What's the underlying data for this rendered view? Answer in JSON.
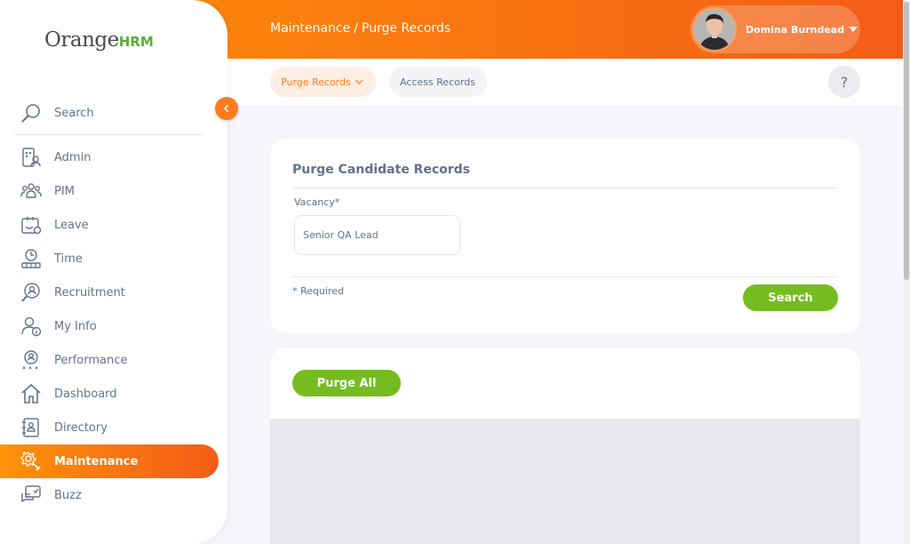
{
  "header": {
    "breadcrumb_module": "Maintenance",
    "breadcrumb_sep": "/",
    "breadcrumb_page": "Purge Records",
    "user_name": "Domina Burndead",
    "help_label": "?"
  },
  "subnav": {
    "tabs": [
      {
        "label": "Purge Records",
        "active": true
      },
      {
        "label": "Access Records",
        "active": false
      }
    ]
  },
  "sidebar": {
    "logo_orange": "Orange",
    "logo_hrm": "HRM",
    "search_label": "Search",
    "items": [
      {
        "label": "Admin",
        "icon": "admin-icon"
      },
      {
        "label": "PIM",
        "icon": "pim-icon"
      },
      {
        "label": "Leave",
        "icon": "leave-icon"
      },
      {
        "label": "Time",
        "icon": "time-icon"
      },
      {
        "label": "Recruitment",
        "icon": "recruitment-icon"
      },
      {
        "label": "My Info",
        "icon": "my-info-icon"
      },
      {
        "label": "Performance",
        "icon": "performance-icon"
      },
      {
        "label": "Dashboard",
        "icon": "dashboard-icon"
      },
      {
        "label": "Directory",
        "icon": "directory-icon"
      },
      {
        "label": "Maintenance",
        "icon": "maintenance-icon",
        "active": true
      },
      {
        "label": "Buzz",
        "icon": "buzz-icon"
      }
    ]
  },
  "form": {
    "title": "Purge Candidate Records",
    "vacancy_label": "Vacancy*",
    "vacancy_value": "Senior QA Lead",
    "required_note": "* Required",
    "search_button": "Search"
  },
  "results": {
    "purge_all_button": "Purge All"
  },
  "colors": {
    "brand_orange": "#ff7b1d",
    "brand_green": "#76bc21",
    "text_muted": "#64728c"
  }
}
